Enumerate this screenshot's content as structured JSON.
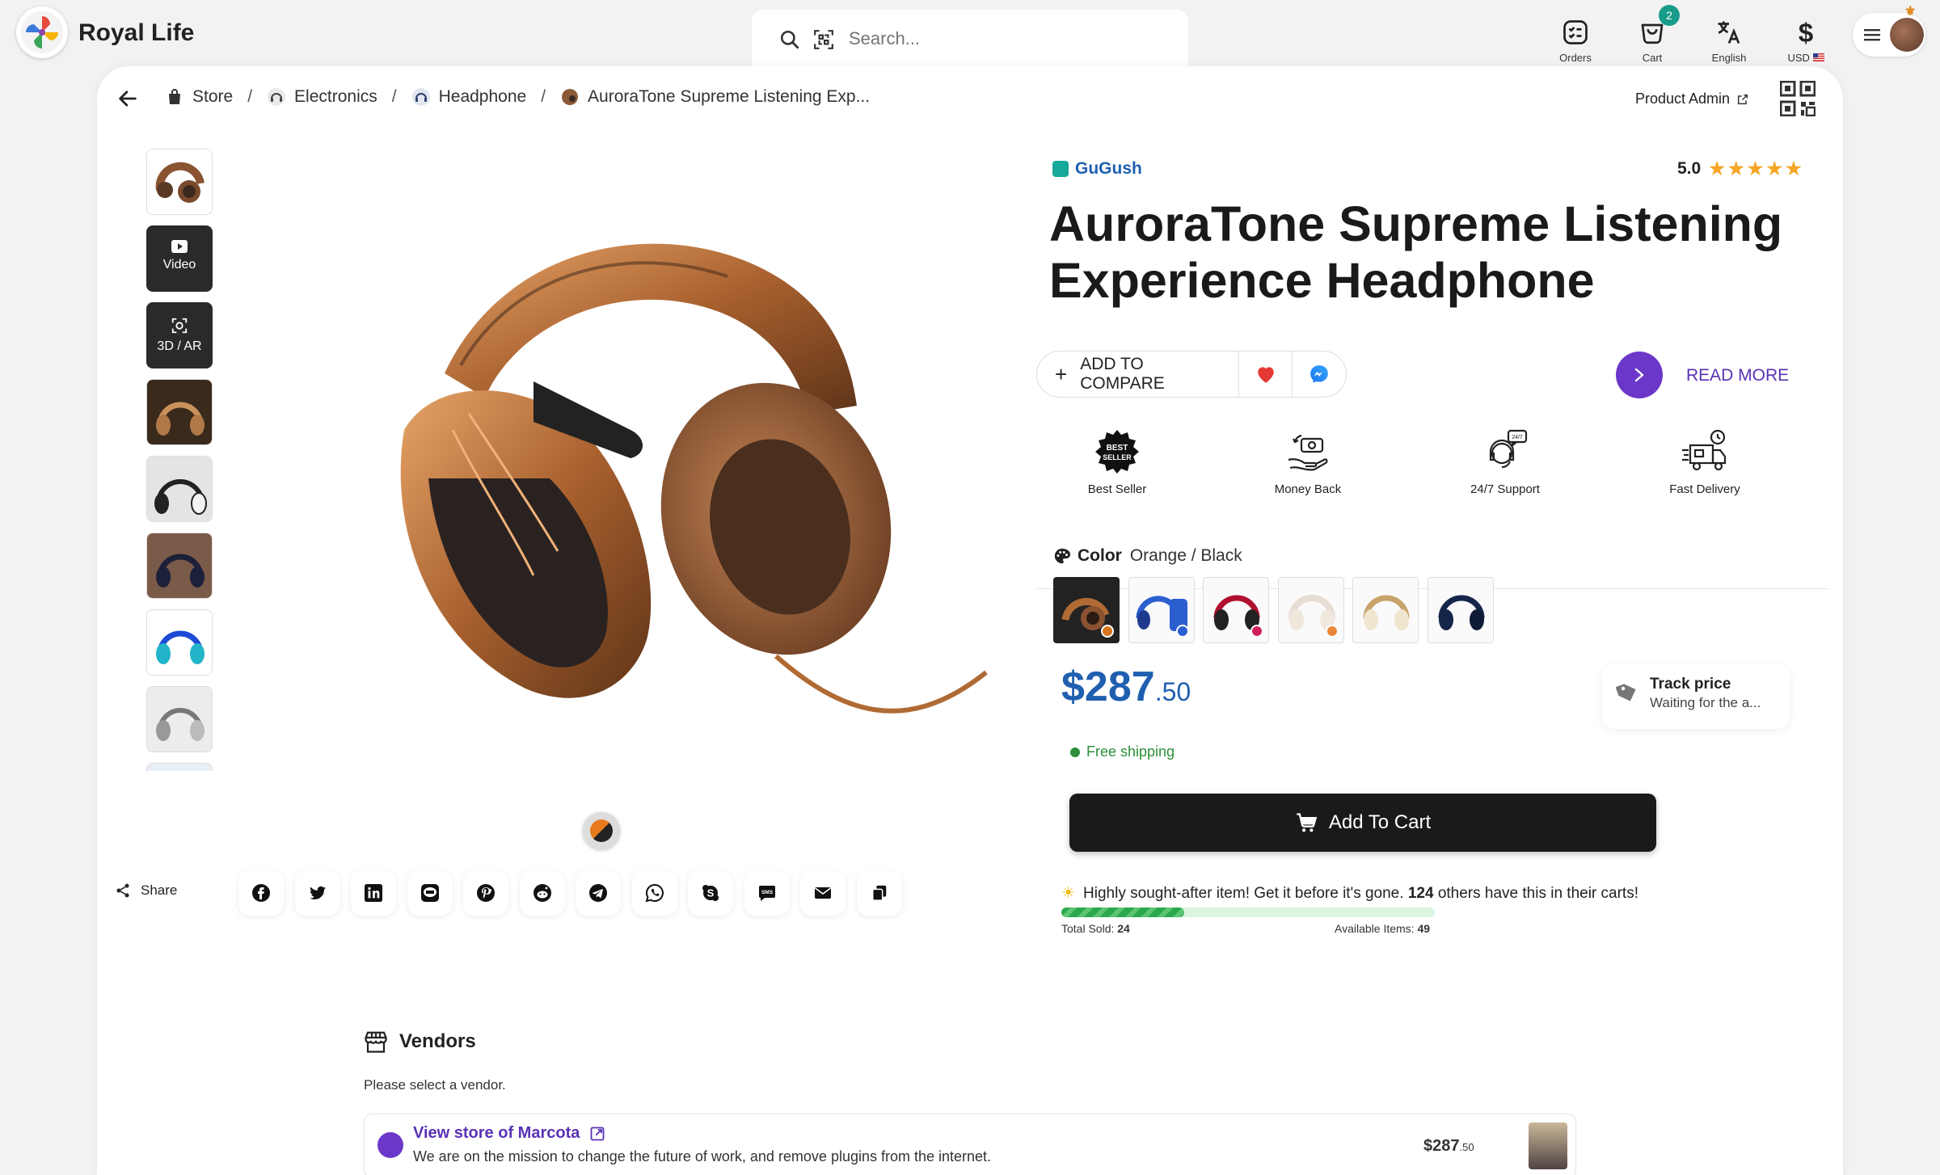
{
  "app": {
    "title": "Royal Life"
  },
  "search": {
    "placeholder": "Search..."
  },
  "top_actions": [
    {
      "label": "Orders",
      "icon": "orders-icon"
    },
    {
      "label": "Cart",
      "icon": "cart-icon",
      "badge": "2"
    },
    {
      "label": "English",
      "icon": "translate-icon"
    },
    {
      "label": "USD",
      "icon": "dollar-icon"
    }
  ],
  "breadcrumb": [
    "Store",
    "Electronics",
    "Headphone",
    "AuroraTone Supreme Listening Exp..."
  ],
  "product_admin": "Product Admin",
  "thumbs": {
    "video": "Video",
    "ar": "3D / AR"
  },
  "brand": "GuGush",
  "rating": {
    "value": "5.0",
    "stars": "★★★★★"
  },
  "product": {
    "title": "AuroraTone Supreme Listening Experience Headphone",
    "price_main": "$287",
    "price_cents": ".50"
  },
  "actions": {
    "compare": "ADD TO COMPARE",
    "read_more": "READ MORE"
  },
  "features": [
    {
      "label": "Best Seller",
      "icon": "best-seller-badge-icon"
    },
    {
      "label": "Money Back",
      "icon": "money-back-icon"
    },
    {
      "label": "24/7 Support",
      "icon": "support-icon"
    },
    {
      "label": "Fast Delivery",
      "icon": "fast-delivery-icon"
    }
  ],
  "color": {
    "label": "Color",
    "value": "Orange / Black"
  },
  "swatch_colors": [
    "#d87520",
    "#2b5fd0",
    "#d0215a",
    "#e8873a",
    "#efe6cf",
    "#15254a"
  ],
  "track_price": {
    "title": "Track price",
    "subtitle": "Waiting for the a..."
  },
  "shipping": "Free shipping",
  "add_to_cart": "Add To Cart",
  "stock": {
    "message_pre": "Highly sought-after item! Get it before it's gone.",
    "carts_count": "124",
    "message_post": "others have this in their carts!",
    "sold_label": "Total Sold:",
    "sold_value": "24",
    "available_label": "Available Items:",
    "available_value": "49",
    "progress_fraction": 0.33
  },
  "share": {
    "label": "Share",
    "networks": [
      "facebook-icon",
      "twitter-icon",
      "linkedin-icon",
      "line-icon",
      "pinterest-icon",
      "reddit-icon",
      "telegram-icon",
      "whatsapp-icon",
      "skype-icon",
      "sms-icon",
      "email-icon",
      "copy-icon"
    ]
  },
  "vendors": {
    "title": "Vendors",
    "hint": "Please select a vendor.",
    "items": [
      {
        "name": "View store of Marcota",
        "description": "We are on the mission to change the future of work, and remove plugins from the internet.",
        "price_main": "$287",
        "price_cents": ".50"
      }
    ]
  },
  "colors": {
    "accent_purple": "#6b37c9",
    "price_blue": "#1f5fb0",
    "success_green": "#2d8f3a"
  }
}
